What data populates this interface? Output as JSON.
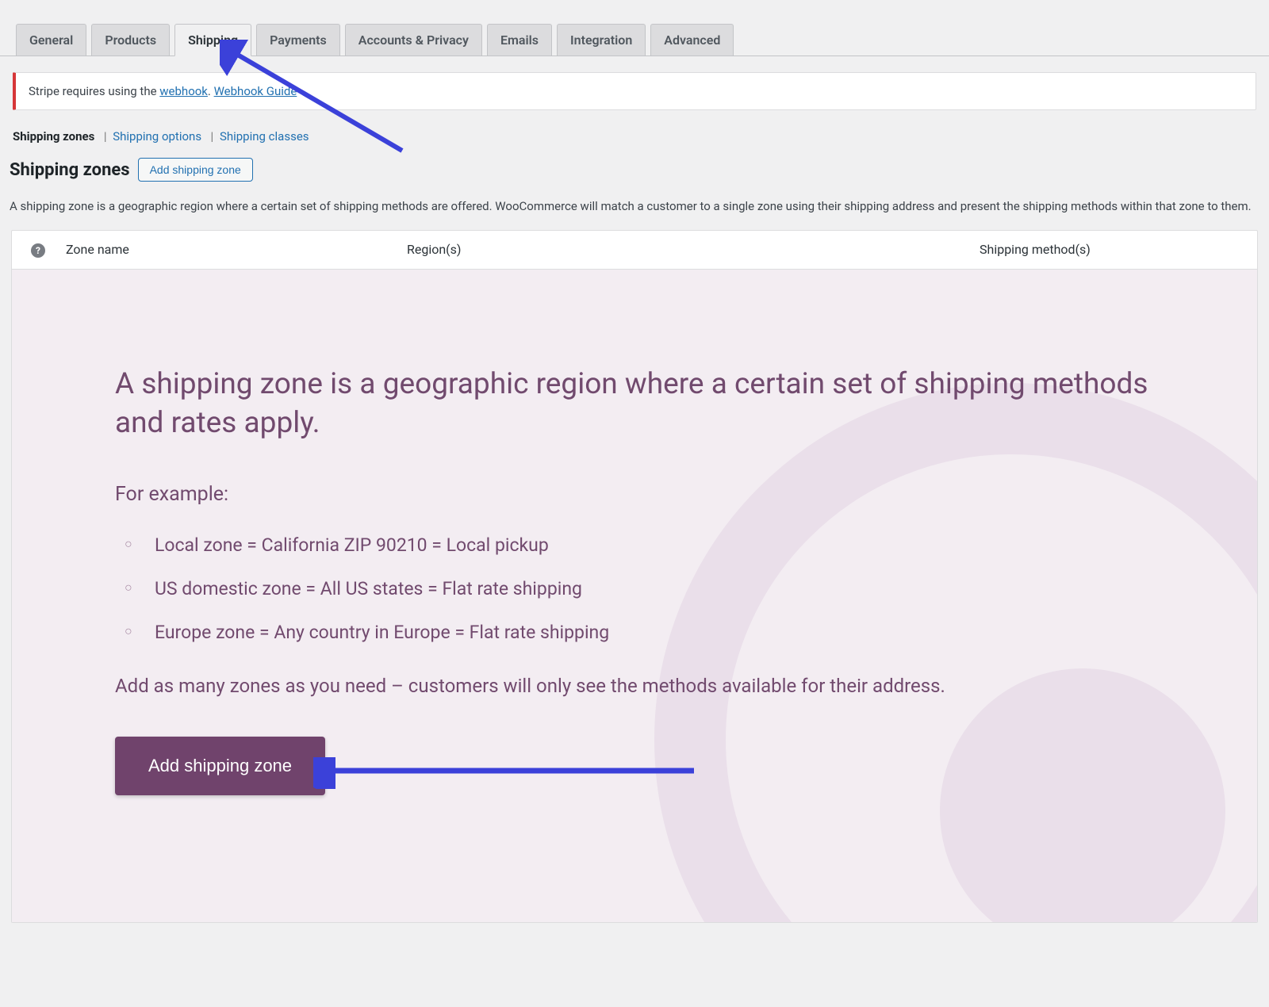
{
  "tabs": {
    "general": "General",
    "products": "Products",
    "shipping": "Shipping",
    "payments": "Payments",
    "accounts": "Accounts & Privacy",
    "emails": "Emails",
    "integration": "Integration",
    "advanced": "Advanced"
  },
  "notice": {
    "prefix": "Stripe requires using the ",
    "webhook_link": "webhook",
    "period": ". ",
    "guide_link": "Webhook Guide"
  },
  "subsub": {
    "zones": "Shipping zones",
    "options": "Shipping options",
    "classes": "Shipping classes"
  },
  "heading": {
    "title": "Shipping zones",
    "add_button": "Add shipping zone"
  },
  "description": "A shipping zone is a geographic region where a certain set of shipping methods are offered. WooCommerce will match a customer to a single zone using their shipping address and present the shipping methods within that zone to them.",
  "table": {
    "col_zone_name": "Zone name",
    "col_regions": "Region(s)",
    "col_methods": "Shipping method(s)"
  },
  "empty": {
    "intro": "A shipping zone is a geographic region where a certain set of shipping methods and rates apply.",
    "for_example": "For example:",
    "examples": [
      "Local zone = California ZIP 90210 = Local pickup",
      "US domestic zone = All US states = Flat rate shipping",
      "Europe zone = Any country in Europe = Flat rate shipping"
    ],
    "note": "Add as many zones as you need – customers will only see the methods available for their address.",
    "cta": "Add shipping zone"
  }
}
